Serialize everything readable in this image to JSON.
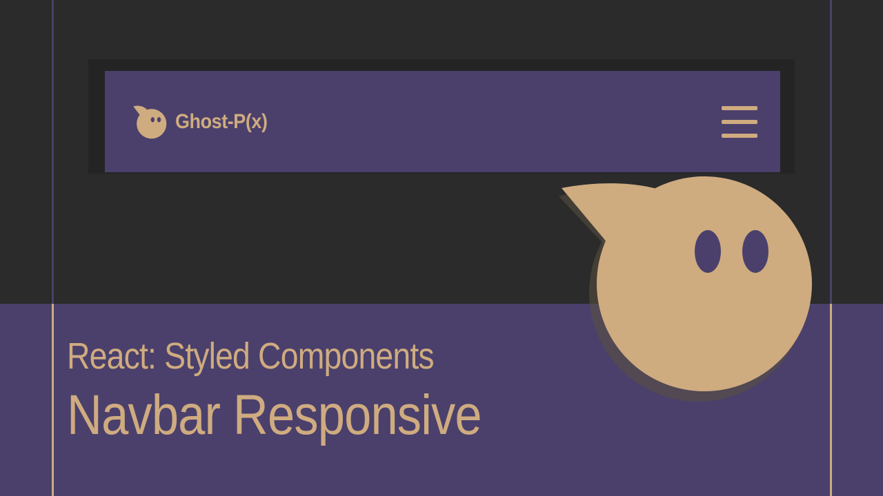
{
  "navbar": {
    "brand_name": "Ghost-P(x)",
    "logo_icon": "ghost-icon",
    "menu_icon": "hamburger-menu-icon"
  },
  "caption": {
    "subtitle": "React: Styled Components",
    "title": "Navbar Responsive"
  },
  "colors": {
    "background_dark": "#2b2b2b",
    "purple": "#4a406b",
    "accent_tan": "#cfab80"
  }
}
